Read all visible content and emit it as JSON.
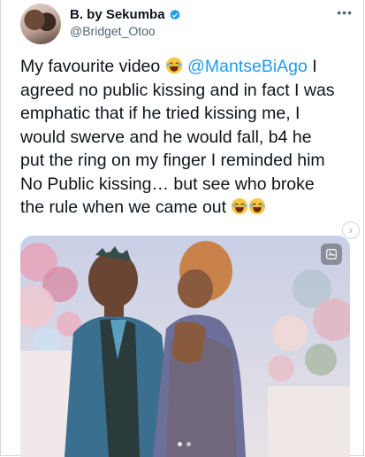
{
  "author": {
    "display_name": "B. by Sekumba",
    "handle": "@Bridget_Otoo",
    "verified": true
  },
  "more_icon": "ellipsis-icon",
  "tweet": {
    "text_1": "My favourite video ",
    "mention": "@MantseBiAgo",
    "text_2": " I agreed no public kissing and in fact I was emphatic that if he tried kissing me, I would swerve and he would fall, b4 he put the ring on my finger I reminded him No Public kissing… but see who broke the rule when we came out "
  },
  "media": {
    "type": "photo",
    "description_icons": [
      "media-tag-icon"
    ],
    "carousel_count": 2,
    "carousel_active": 1
  },
  "colors": {
    "link": "#1d9bf0",
    "text": "#0f1419",
    "muted": "#536471",
    "verified": "#1d9bf0"
  }
}
